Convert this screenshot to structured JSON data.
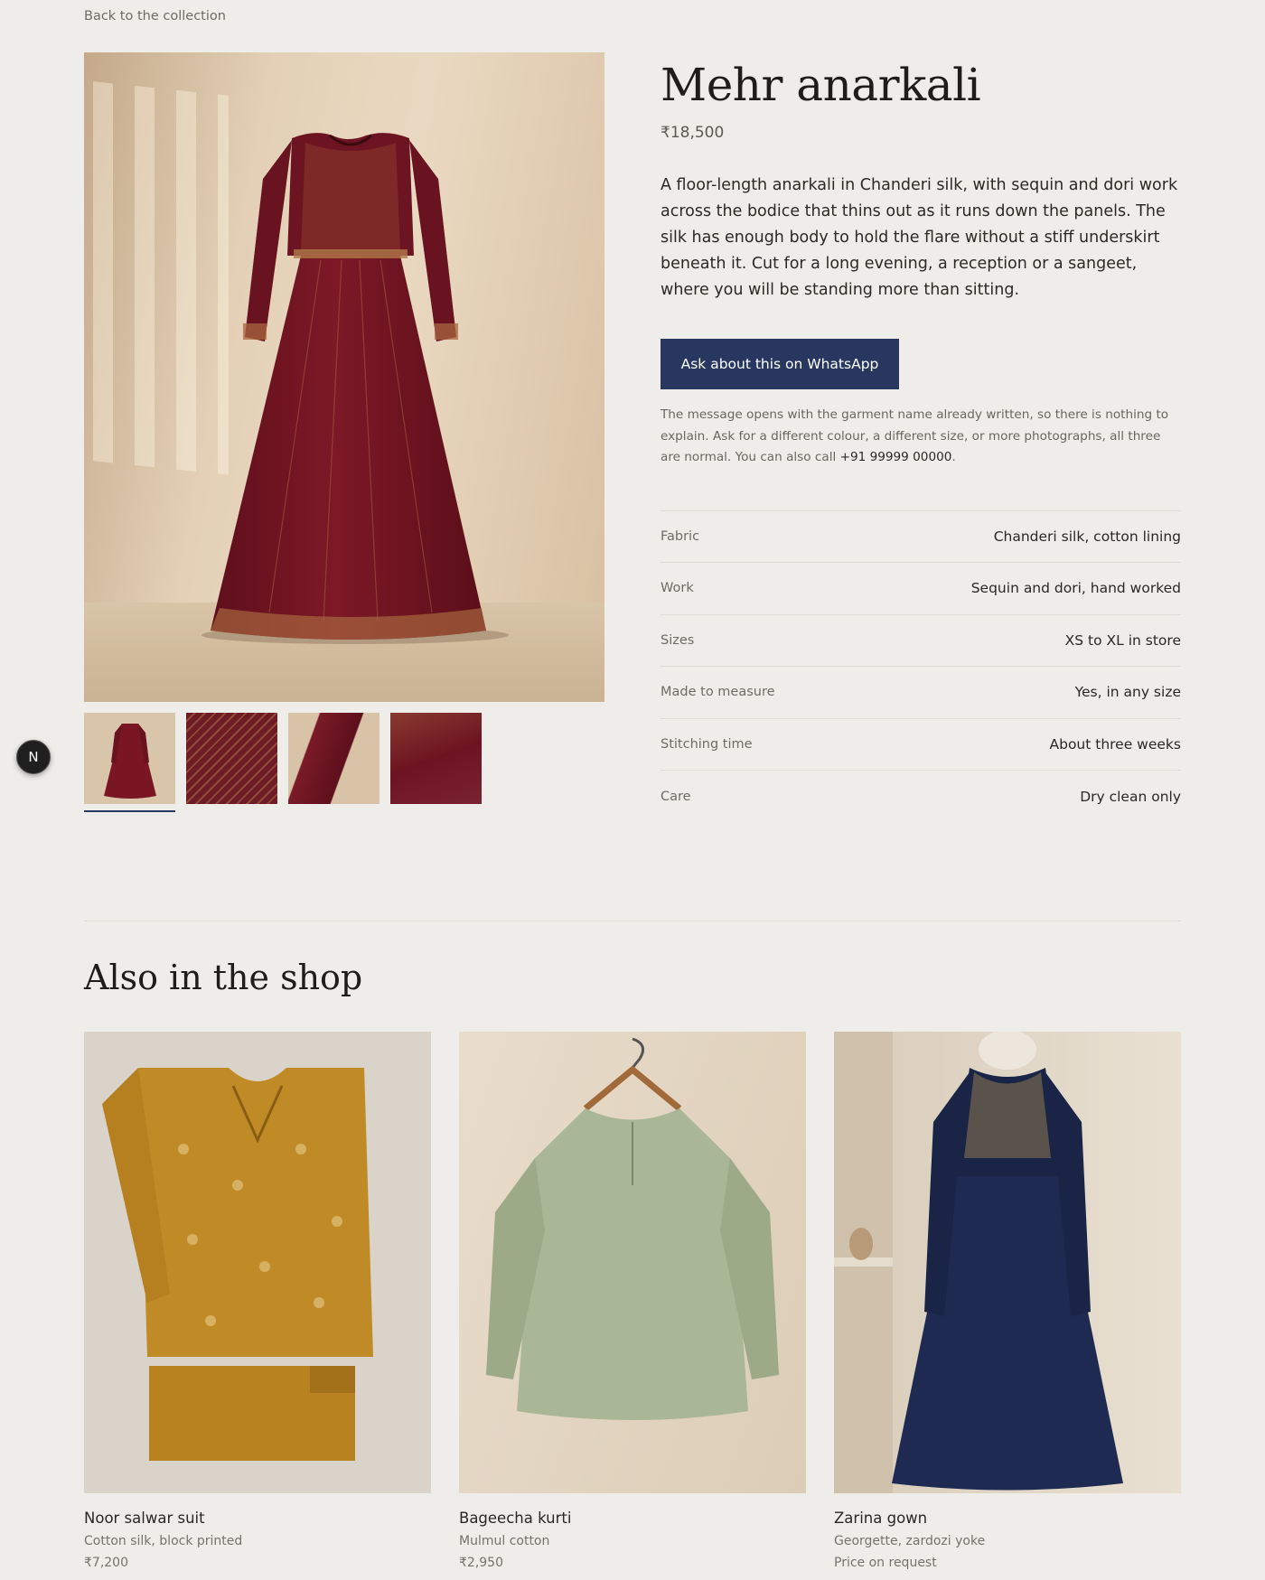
{
  "nav": {
    "back_label": "Back to the collection"
  },
  "product": {
    "title": "Mehr anarkali",
    "price": "₹18,500",
    "description": "A floor-length anarkali in Chanderi silk, with sequin and dori work across the bodice that thins out as it runs down the panels. The silk has enough body to hold the flare without a stiff underskirt beneath it. Cut for a long evening, a reception or a sangeet, where you will be standing more than sitting.",
    "whatsapp_label": "Ask about this on WhatsApp",
    "note_text": "The message opens with the garment name already written, so there is nothing to explain. Ask for a different colour, a different size, or more photographs, all three are normal. You can also call ",
    "note_phone": "+91 99999 00000",
    "note_end": ".",
    "specs": [
      {
        "label": "Fabric",
        "value": "Chanderi silk, cotton lining"
      },
      {
        "label": "Work",
        "value": "Sequin and dori, hand worked"
      },
      {
        "label": "Sizes",
        "value": "XS to XL in store"
      },
      {
        "label": "Made to measure",
        "value": "Yes, in any size"
      },
      {
        "label": "Stitching time",
        "value": "About three weeks"
      },
      {
        "label": "Care",
        "value": "Dry clean only"
      }
    ]
  },
  "badge": {
    "letter": "N"
  },
  "related": {
    "title": "Also in the shop",
    "items": [
      {
        "name": "Noor salwar suit",
        "fabric": "Cotton silk, block printed",
        "price": "₹7,200"
      },
      {
        "name": "Bageecha kurti",
        "fabric": "Mulmul cotton",
        "price": "₹2,950"
      },
      {
        "name": "Zarina gown",
        "fabric": "Georgette, zardozi yoke",
        "price": "Price on request"
      }
    ]
  },
  "colors": {
    "accent": "#27375f",
    "background": "#efedea",
    "maroon": "#7a1624",
    "mustard": "#c08a26",
    "sage": "#a9b796",
    "navy": "#1a2446"
  }
}
